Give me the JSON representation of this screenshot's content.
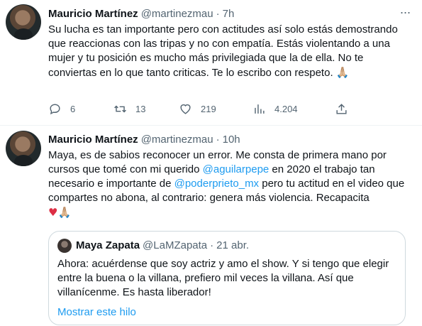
{
  "tweet1": {
    "name": "Mauricio Martínez",
    "handle": "@martinezmau",
    "dot": "·",
    "time": "7h",
    "more_icon": "ellipsis-icon",
    "text": "Su lucha es tan importante pero con actitudes así solo estás demostrando que reaccionas con las tripas y no con empatía. Estás violentando a una mujer y tu posición es mucho más privilegiada que la de ella. No te conviertas en lo que tanto criticas. Te lo escribo con respeto. ",
    "emoji": "🙏🏼",
    "actions": {
      "reply": "6",
      "retweet": "13",
      "like": "219",
      "views": "4.204"
    }
  },
  "tweet2": {
    "name": "Mauricio Martínez",
    "handle": "@martinezmau",
    "dot": "·",
    "time": "10h",
    "text_part1": "Maya, es de sabios reconocer un error. Me consta de primera mano por cursos que tomé con mi querido ",
    "mention1": "@aguilarpepe",
    "text_part2": " en 2020 el trabajo tan necesario e importante de ",
    "mention2": "@poderprieto_mx",
    "text_part3": " pero tu actitud en el video que compartes no abona, al contrario: genera más violencia. Recapacita",
    "emoji_heart": "♥",
    "emoji_hands": "🙏🏼"
  },
  "quote": {
    "name": "Maya Zapata",
    "handle": "@LaMZapata",
    "dot": "·",
    "time": "21 abr.",
    "text": "Ahora: acuérdense que soy actriz y amo el show. Y si tengo que elegir entre la buena o la villana, prefiero mil veces la villana. Así que villanícenme. Es hasta liberador!",
    "show_thread": "Mostrar este hilo"
  }
}
